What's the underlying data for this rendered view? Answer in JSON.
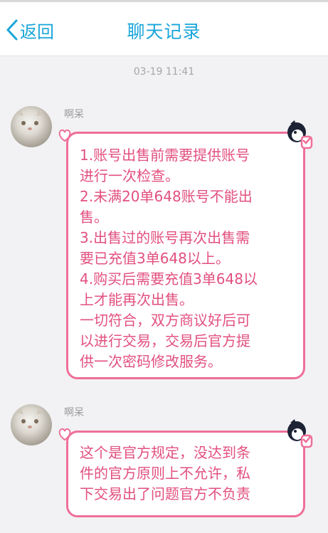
{
  "nav": {
    "back_label": "返回",
    "title": "聊天记录"
  },
  "timestamp": "03-19 11:41",
  "colors": {
    "accent": "#19a5d9",
    "bubble_border": "#ee6f98",
    "bubble_text": "#e2507f"
  },
  "messages": [
    {
      "sender": "啊呆",
      "text": "1.账号出售前需要提供账号\n进行一次检查。\n2.未满20单648账号不能出\n售。\n3.出售过的账号再次出售需\n要已充值3单648以上。\n4.购买后需要充值3单648以\n上才能再次出售。\n一切符合，双方商议好后可\n以进行交易，交易后官方提\n供一次密码修改服务。"
    },
    {
      "sender": "啊呆",
      "text": "这个是官方规定，没达到条\n件的官方原则上不允许，私\n下交易出了问题官方不负责"
    }
  ]
}
